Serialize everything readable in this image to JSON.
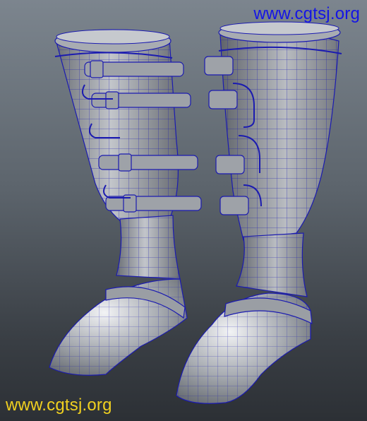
{
  "watermark": {
    "top": "www.cgtsj.org",
    "bottom": "www.cgtsj.org",
    "top_color": "#1414e6",
    "bottom_color": "#f0d020"
  },
  "model": {
    "subject": "boots-wireframe-mesh",
    "surface_color": "#8e9298",
    "wire_color": "#1b1bb0"
  }
}
